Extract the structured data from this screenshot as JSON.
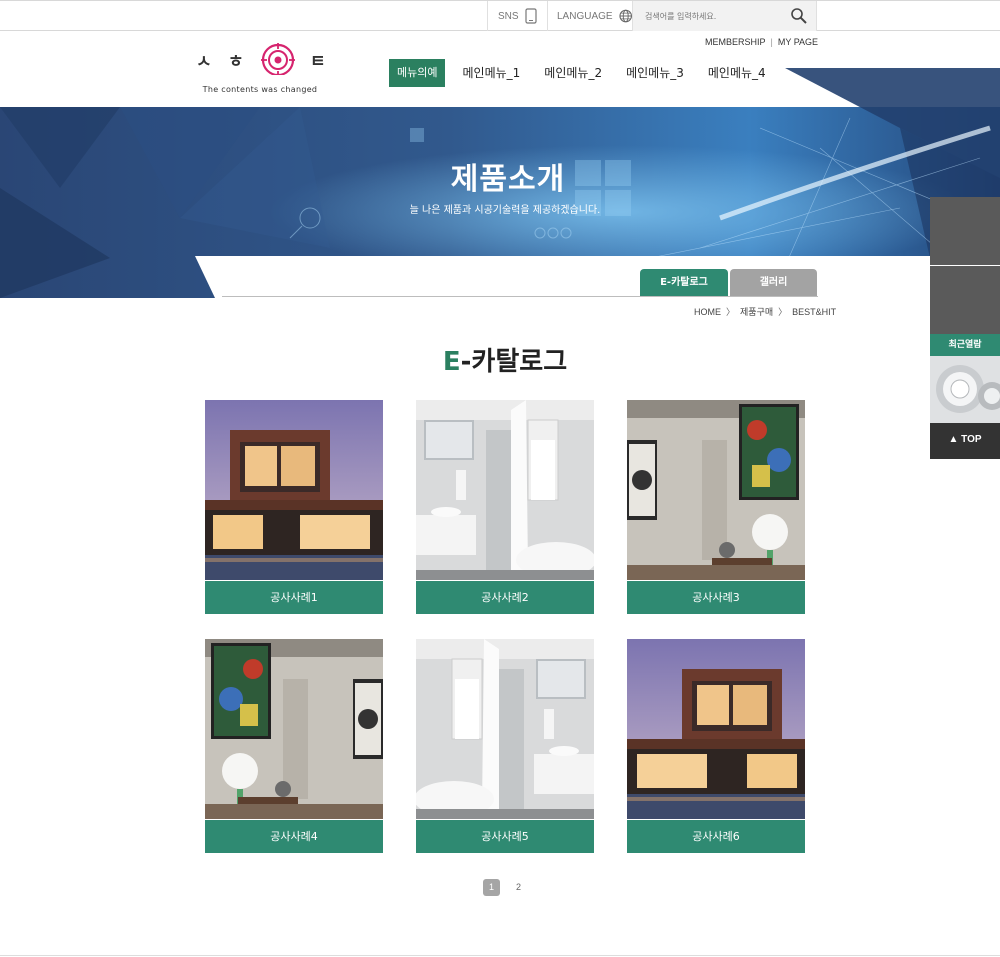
{
  "utility": {
    "sns_label": "SNS",
    "language_label": "LANGUAGE",
    "search_placeholder": "검색어를 입력하세요."
  },
  "logo": {
    "letters": [
      "ㅅ",
      "ㅎ",
      "ㅌ"
    ],
    "tagline": "The contents was changed"
  },
  "members": {
    "membership": "MEMBERSHIP",
    "separator": "|",
    "mypage": "MY PAGE"
  },
  "nav": {
    "items": [
      {
        "label": "메뉴의예"
      },
      {
        "label": "메인메뉴_1"
      },
      {
        "label": "메인메뉴_2"
      },
      {
        "label": "메인메뉴_3"
      },
      {
        "label": "메인메뉴_4"
      }
    ]
  },
  "banner": {
    "title": "제품소개",
    "subtitle": "늘 나은 제품과 시공기술력을 제공하겠습니다."
  },
  "tabs": {
    "items": [
      {
        "label": "E-카탈로그"
      },
      {
        "label": "갤러리"
      }
    ]
  },
  "breadcrumb": {
    "home": "HOME",
    "level1": "제품구매",
    "level2": "BEST&HIT",
    "chevron": "〉"
  },
  "page_title": {
    "accent": "E",
    "rest": "-카탈로그"
  },
  "gallery": {
    "items": [
      {
        "caption": "공사사례1",
        "image": "modern-house-exterior"
      },
      {
        "caption": "공사사례2",
        "image": "bathroom-interior"
      },
      {
        "caption": "공사사례3",
        "image": "living-room-lamp"
      },
      {
        "caption": "공사사례4",
        "image": "living-room-lamp"
      },
      {
        "caption": "공사사례5",
        "image": "bathroom-interior"
      },
      {
        "caption": "공사사례6",
        "image": "modern-house-exterior"
      }
    ]
  },
  "pagination": {
    "pages": [
      "1",
      "2"
    ],
    "current": "1"
  },
  "quick_panel": {
    "recent_label": "최근열람",
    "top_label": "▲ TOP"
  },
  "colors": {
    "accent_green": "#2f8a72",
    "nav_active": "#2b8060",
    "banner_blue": "#2a4a7c",
    "tab_inactive": "#a3a3a3",
    "logo_pink": "#d6246e"
  }
}
